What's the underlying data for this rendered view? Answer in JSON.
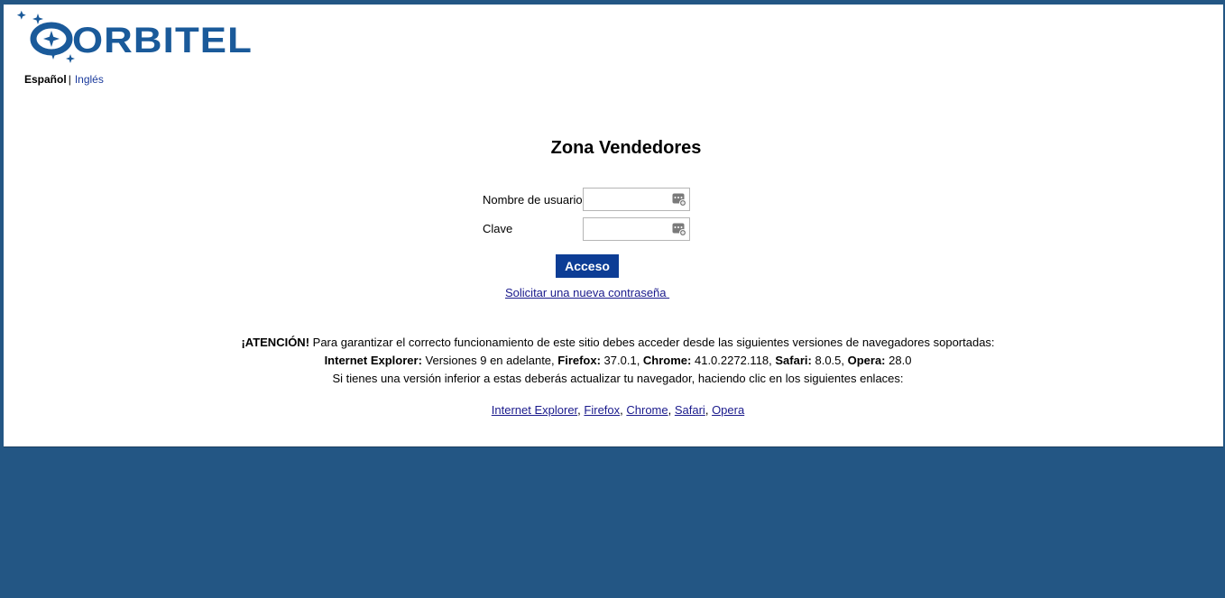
{
  "brand": {
    "logo_text": "ORBITEL",
    "logo_color": "#1a5a9a"
  },
  "language": {
    "active": "Español",
    "separator": "|",
    "other": "Inglés"
  },
  "login": {
    "title": "Zona Vendedores",
    "username_label": "Nombre de usuario",
    "username_value": "",
    "password_label": "Clave",
    "password_value": "",
    "submit_label": "Acceso",
    "reset_link": "Solicitar una nueva contraseña "
  },
  "notice": {
    "line1_strong": "¡ATENCIÓN!",
    "line1_text": " Para garantizar el correcto funcionamiento de este sitio debes acceder desde las siguientes versiones de navegadores soportadas:",
    "ie_label": "Internet Explorer:",
    "ie_value": " Versiones 9 en adelante, ",
    "ff_label": "Firefox:",
    "ff_value": " 37.0.1, ",
    "chrome_label": "Chrome:",
    "chrome_value": " 41.0.2272.118, ",
    "safari_label": "Safari:",
    "safari_value": " 8.0.5, ",
    "opera_label": "Opera:",
    "opera_value": " 28.0",
    "line3": "Si tienes una versión inferior a estas deberás actualizar tu navegador, haciendo clic en los siguientes enlaces:"
  },
  "browser_links": {
    "items": [
      "Internet Explorer",
      "Firefox",
      "Chrome",
      "Safari",
      "Opera"
    ],
    "separator": ", "
  },
  "colors": {
    "background": "#235684",
    "button": "#0d3d95",
    "link": "#1a1a8c"
  }
}
